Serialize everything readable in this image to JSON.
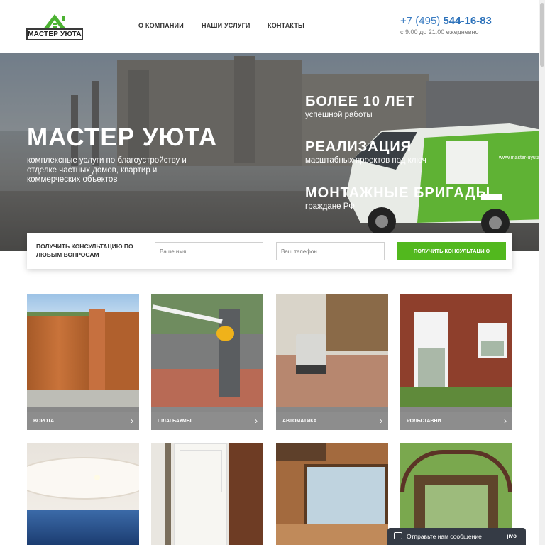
{
  "header": {
    "logo_text": "МАСТЕР УЮТА",
    "nav": [
      "О КОМПАНИИ",
      "НАШИ УСЛУГИ",
      "КОНТАКТЫ"
    ],
    "phone_code": "+7  (495)",
    "phone_number": "544-16-83",
    "hours": "с 9:00 до 21:00 ежедневно"
  },
  "hero": {
    "title": "МАСТЕР УЮТА",
    "subtitle": "комплексные услуги по благоустройству и отделке частных домов, квартир и коммерческих объектов",
    "stats": [
      {
        "big": "БОЛЕЕ 10 ЛЕТ",
        "small": "успешной работы"
      },
      {
        "big": "РЕАЛИЗАЦИЯ",
        "small": "масштабных проектов под ключ"
      },
      {
        "big": "МОНТАЖНЫЕ БРИГАДЫ",
        "small": "граждане РФ"
      }
    ],
    "van_text": "www.master-uyuta.ru"
  },
  "consult": {
    "label": "ПОЛУЧИТЬ КОНСУЛЬТАЦИЮ ПО ЛЮБЫМ ВОПРОСАМ",
    "name_placeholder": "Ваше имя",
    "phone_placeholder": "Ваш телефон",
    "button": "ПОЛУЧИТЬ КОНСУЛЬТАЦИЮ"
  },
  "services": [
    "ВОРОТА",
    "ШЛАГБАУМЫ",
    "АВТОМАТИКА",
    "РОЛЬСТАВНИ"
  ],
  "chat": {
    "text": "Отправьте нам сообщение",
    "brand": "jivo"
  },
  "colors": {
    "accent_green": "#52b81e",
    "phone_blue": "#2e73bb",
    "caption_gray": "#8d8d8d"
  }
}
